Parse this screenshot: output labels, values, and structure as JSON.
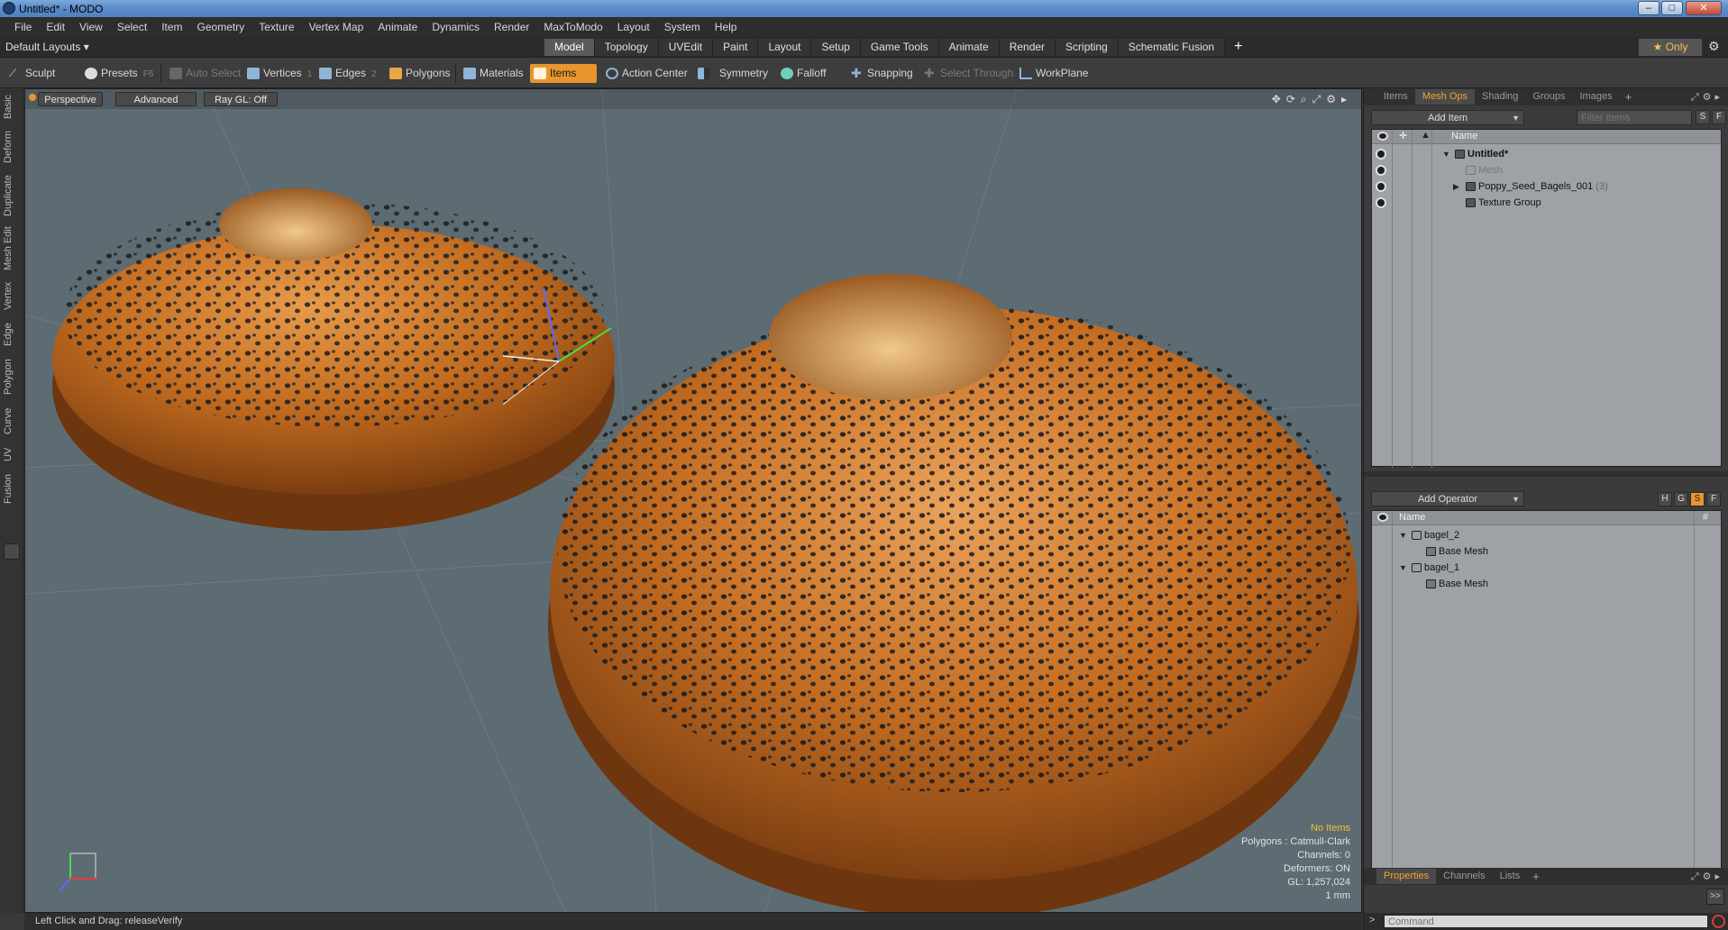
{
  "window": {
    "title": "Untitled* - MODO"
  },
  "menu": [
    "File",
    "Edit",
    "View",
    "Select",
    "Item",
    "Geometry",
    "Texture",
    "Vertex Map",
    "Animate",
    "Dynamics",
    "Render",
    "MaxToModo",
    "Layout",
    "System",
    "Help"
  ],
  "layout": {
    "selector": "Default Layouts ▾",
    "tabs": [
      "Model",
      "Topology",
      "UVEdit",
      "Paint",
      "Layout",
      "Setup",
      "Game Tools",
      "Animate",
      "Render",
      "Scripting",
      "Schematic Fusion"
    ],
    "active_tab": "Model",
    "only_label": "★  Only"
  },
  "toolbar": {
    "sculpt": "Sculpt",
    "presets": "Presets",
    "presets_key": "F6",
    "auto_select": "Auto Select",
    "vertices": "Vertices",
    "vertices_key": "1",
    "edges": "Edges",
    "edges_key": "2",
    "polygons": "Polygons",
    "materials": "Materials",
    "items": "Items",
    "action_center": "Action Center",
    "symmetry": "Symmetry",
    "falloff": "Falloff",
    "snapping": "Snapping",
    "select_through": "Select Through",
    "workplane": "WorkPlane"
  },
  "left_tabs": [
    "Basic",
    "Deform",
    "Duplicate",
    "Mesh Edit",
    "Vertex",
    "Edge",
    "Polygon",
    "Curve",
    "UV",
    "Fusion"
  ],
  "viewport": {
    "perspective": "Perspective",
    "advanced": "Advanced",
    "raygl": "Ray GL: Off",
    "stats": {
      "no_items": "No Items",
      "polygons": "Polygons : Catmull-Clark",
      "channels": "Channels: 0",
      "deformers": "Deformers: ON",
      "gl": "GL: 1,257,024",
      "scale": "1 mm"
    }
  },
  "status": {
    "text": "Left Click and Drag:   releaseVerify"
  },
  "items_panel": {
    "tabs": [
      "Items",
      "Mesh Ops",
      "Shading",
      "Groups",
      "Images"
    ],
    "active_tab": "Mesh Ops",
    "add_item": "Add Item",
    "filter_placeholder": "Filter Items",
    "s_btn": "S",
    "f_btn": "F",
    "col_name": "Name",
    "rows": [
      {
        "label": "Untitled*"
      },
      {
        "label": "Mesh"
      },
      {
        "label": "Poppy_Seed_Bagels_001",
        "count": "(3)"
      },
      {
        "label": "Texture Group"
      }
    ]
  },
  "meshops_panel": {
    "add_operator": "Add Operator",
    "btn_h": "H",
    "btn_g": "G",
    "btn_s": "S",
    "btn_f": "F",
    "col_name": "Name",
    "col_hash": "#",
    "rows": [
      {
        "label": "bagel_2"
      },
      {
        "label": "Base Mesh"
      },
      {
        "label": "bagel_1"
      },
      {
        "label": "Base Mesh"
      }
    ]
  },
  "props_panel": {
    "tabs": [
      "Properties",
      "Channels",
      "Lists"
    ],
    "active_tab": "Properties"
  },
  "command": {
    "placeholder": "Command"
  },
  "colors": {
    "accent": "#e8952e",
    "viewport_bg": "#5d6b73",
    "bagel": "#c06a1f",
    "seed": "#1c1c1c"
  }
}
